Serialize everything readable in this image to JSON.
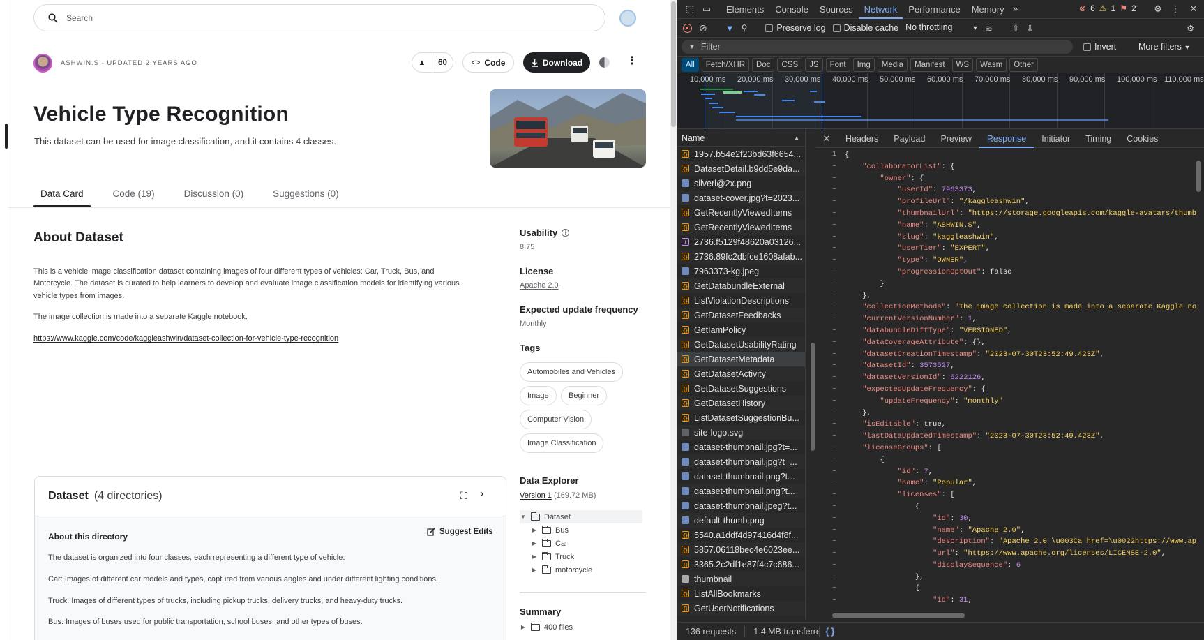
{
  "kaggle": {
    "search_placeholder": "Search",
    "owner_line": "ASHWIN.S · UPDATED 2 YEARS AGO",
    "vote_count": "60",
    "code_label": "Code",
    "download_label": "Download",
    "title": "Vehicle Type Recognition",
    "subtitle": "This dataset can be used for image classification, and it contains 4 classes.",
    "tabs": [
      {
        "label": "Data Card"
      },
      {
        "label": "Code (19)"
      },
      {
        "label": "Discussion (0)"
      },
      {
        "label": "Suggestions (0)"
      }
    ],
    "about_heading": "About Dataset",
    "about_p1": "This is a vehicle image classification dataset containing images of four different types of vehicles: Car, Truck, Bus, and",
    "about_p1b": "Motorcycle. The dataset is curated to help learners to develop and evaluate image classification models for identifying various",
    "about_p1c": "vehicle types from images.",
    "about_p2": "The image collection is made into a separate Kaggle notebook.",
    "about_link": "https://www.kaggle.com/code/kaggleashwin/dataset-collection-for-vehicle-type-recognition",
    "sidebar": {
      "usability_label": "Usability",
      "usability_value": "8.75",
      "license_label": "License",
      "license_value": "Apache 2.0",
      "update_label": "Expected update frequency",
      "update_value": "Monthly",
      "tags_label": "Tags",
      "tags": [
        "Automobiles and Vehicles",
        "Image",
        "Beginner",
        "Computer Vision",
        "Image Classification"
      ],
      "explorer_label": "Data Explorer",
      "version_label": "Version 1",
      "version_size": "(169.72 MB)",
      "tree_root": "Dataset",
      "tree_children": [
        "Bus",
        "Car",
        "Truck",
        "motorcycle"
      ],
      "summary_label": "Summary",
      "summary_files": "400 files"
    },
    "dataset_card": {
      "title": "Dataset",
      "count": "(4 directories)",
      "dir_heading": "About this directory",
      "suggest_label": "Suggest Edits",
      "lines": [
        "The dataset is organized into four classes, each representing a different type of vehicle:",
        "Car: Images of different car models and types, captured from various angles and under different lighting conditions.",
        "Truck: Images of different types of trucks, including pickup trucks, delivery trucks, and heavy-duty trucks.",
        "Bus: Images of buses used for public transportation, school buses, and other types of buses."
      ]
    }
  },
  "devtools": {
    "tabs": [
      "Elements",
      "Console",
      "Sources",
      "Network",
      "Performance",
      "Memory"
    ],
    "active_tab": "Network",
    "errors": "6",
    "warnings": "1",
    "issues": "2",
    "toolbar": {
      "preserve_log": "Preserve log",
      "disable_cache": "Disable cache",
      "throttling": "No throttling"
    },
    "filter": {
      "placeholder": "Filter",
      "invert": "Invert",
      "more_filters": "More filters"
    },
    "types": [
      "All",
      "Fetch/XHR",
      "Doc",
      "CSS",
      "JS",
      "Font",
      "Img",
      "Media",
      "Manifest",
      "WS",
      "Wasm",
      "Other"
    ],
    "timeline_labels": [
      "10,000 ms",
      "20,000 ms",
      "30,000 ms",
      "40,000 ms",
      "50,000 ms",
      "60,000 ms",
      "70,000 ms",
      "80,000 ms",
      "90,000 ms",
      "100,000 ms",
      "110,000 ms"
    ],
    "name_header": "Name",
    "requests": [
      {
        "name": "1957.b54e2f23bd63f6654...",
        "icon": "xhr"
      },
      {
        "name": "DatasetDetail.b9dd5e9da...",
        "icon": "xhr"
      },
      {
        "name": "silverl@2x.png",
        "icon": "img"
      },
      {
        "name": "dataset-cover.jpg?t=2023...",
        "icon": "img"
      },
      {
        "name": "GetRecentlyViewedItems",
        "icon": "xhr"
      },
      {
        "name": "GetRecentlyViewedItems",
        "icon": "xhr"
      },
      {
        "name": "2736.f5129f48620a03126...",
        "icon": "font"
      },
      {
        "name": "2736.89fc2dbfce1608afab...",
        "icon": "xhr"
      },
      {
        "name": "7963373-kg.jpeg",
        "icon": "img"
      },
      {
        "name": "GetDatabundleExternal",
        "icon": "xhr"
      },
      {
        "name": "ListViolationDescriptions",
        "icon": "xhr"
      },
      {
        "name": "GetDatasetFeedbacks",
        "icon": "xhr"
      },
      {
        "name": "GetIamPolicy",
        "icon": "xhr"
      },
      {
        "name": "GetDatasetUsabilityRating",
        "icon": "xhr"
      },
      {
        "name": "GetDatasetMetadata",
        "icon": "xhr"
      },
      {
        "name": "GetDatasetActivity",
        "icon": "xhr"
      },
      {
        "name": "GetDatasetSuggestions",
        "icon": "xhr"
      },
      {
        "name": "GetDatasetHistory",
        "icon": "xhr"
      },
      {
        "name": "ListDatasetSuggestionBu...",
        "icon": "xhr"
      },
      {
        "name": "site-logo.svg",
        "icon": "svg"
      },
      {
        "name": "dataset-thumbnail.jpg?t=...",
        "icon": "img"
      },
      {
        "name": "dataset-thumbnail.jpg?t=...",
        "icon": "img"
      },
      {
        "name": "dataset-thumbnail.png?t...",
        "icon": "img"
      },
      {
        "name": "dataset-thumbnail.png?t...",
        "icon": "img"
      },
      {
        "name": "dataset-thumbnail.jpeg?t...",
        "icon": "img"
      },
      {
        "name": "default-thumb.png",
        "icon": "img"
      },
      {
        "name": "5540.a1ddf4d97416d4f8f...",
        "icon": "xhr"
      },
      {
        "name": "5857.06118bec4e6023ee...",
        "icon": "xhr"
      },
      {
        "name": "3365.2c2df1e87f4c7c686...",
        "icon": "xhr"
      },
      {
        "name": "thumbnail",
        "icon": "doc"
      },
      {
        "name": "ListAllBookmarks",
        "icon": "xhr"
      },
      {
        "name": "GetUserNotifications",
        "icon": "xhr"
      }
    ],
    "selected_request": "GetDatasetMetadata",
    "detail_tabs": [
      "Headers",
      "Payload",
      "Preview",
      "Response",
      "Initiator",
      "Timing",
      "Cookies"
    ],
    "active_detail_tab": "Response",
    "response_lines": [
      {
        "ln": "1",
        "text": "{"
      },
      {
        "ln": "–",
        "text": "    \"collaboratorList\": {"
      },
      {
        "ln": "–",
        "text": "        \"owner\": {"
      },
      {
        "ln": "–",
        "text": "            \"userId\": 7963373,"
      },
      {
        "ln": "–",
        "text": "            \"profileUrl\": \"/kaggleashwin\","
      },
      {
        "ln": "–",
        "text": "            \"thumbnailUrl\": \"https://storage.googleapis.com/kaggle-avatars/thumb"
      },
      {
        "ln": "–",
        "text": "            \"name\": \"ASHWIN.S\","
      },
      {
        "ln": "–",
        "text": "            \"slug\": \"kaggleashwin\","
      },
      {
        "ln": "–",
        "text": "            \"userTier\": \"EXPERT\","
      },
      {
        "ln": "–",
        "text": "            \"type\": \"OWNER\","
      },
      {
        "ln": "–",
        "text": "            \"progressionOptOut\": false"
      },
      {
        "ln": "–",
        "text": "        }"
      },
      {
        "ln": "–",
        "text": "    },"
      },
      {
        "ln": "–",
        "text": "    \"collectionMethods\": \"The image collection is made into a separate Kaggle no"
      },
      {
        "ln": "–",
        "text": "    \"currentVersionNumber\": 1,"
      },
      {
        "ln": "–",
        "text": "    \"databundleDiffType\": \"VERSIONED\","
      },
      {
        "ln": "–",
        "text": "    \"dataCoverageAttribute\": {},"
      },
      {
        "ln": "–",
        "text": "    \"datasetCreationTimestamp\": \"2023-07-30T23:52:49.423Z\","
      },
      {
        "ln": "–",
        "text": "    \"datasetId\": 3573527,"
      },
      {
        "ln": "–",
        "text": "    \"datasetVersionId\": 6222126,"
      },
      {
        "ln": "–",
        "text": "    \"expectedUpdateFrequency\": {"
      },
      {
        "ln": "–",
        "text": "        \"updateFrequency\": \"monthly\""
      },
      {
        "ln": "–",
        "text": "    },"
      },
      {
        "ln": "–",
        "text": "    \"isEditable\": true,"
      },
      {
        "ln": "–",
        "text": "    \"lastDataUpdatedTimestamp\": \"2023-07-30T23:52:49.423Z\","
      },
      {
        "ln": "–",
        "text": "    \"licenseGroups\": ["
      },
      {
        "ln": "–",
        "text": "        {"
      },
      {
        "ln": "–",
        "text": "            \"id\": 7,"
      },
      {
        "ln": "–",
        "text": "            \"name\": \"Popular\","
      },
      {
        "ln": "–",
        "text": "            \"licenses\": ["
      },
      {
        "ln": "–",
        "text": "                {"
      },
      {
        "ln": "–",
        "text": "                    \"id\": 30,"
      },
      {
        "ln": "–",
        "text": "                    \"name\": \"Apache 2.0\","
      },
      {
        "ln": "–",
        "text": "                    \"description\": \"Apache 2.0 \\u003Ca href=\\u0022https://www.ap"
      },
      {
        "ln": "–",
        "text": "                    \"url\": \"https://www.apache.org/licenses/LICENSE-2.0\","
      },
      {
        "ln": "–",
        "text": "                    \"displaySequence\": 6"
      },
      {
        "ln": "–",
        "text": "                },"
      },
      {
        "ln": "–",
        "text": "                {"
      },
      {
        "ln": "–",
        "text": "                    \"id\": 31,"
      }
    ],
    "status": {
      "requests": "136 requests",
      "transferred": "1.4 MB transferre"
    }
  }
}
